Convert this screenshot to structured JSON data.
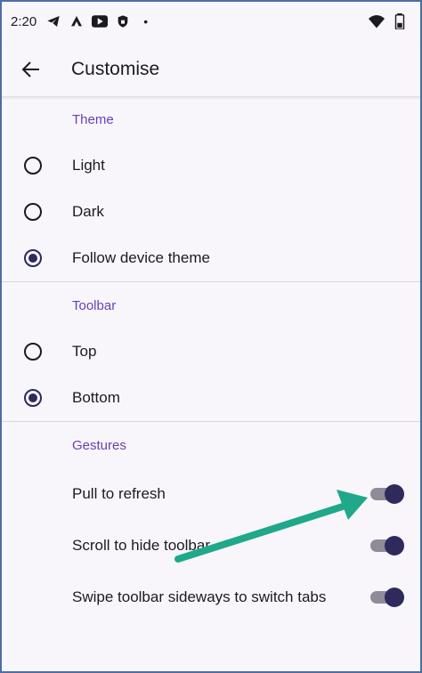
{
  "status_bar": {
    "time": "2:20",
    "dot": "•",
    "icons": [
      "telegram-icon",
      "app-icon",
      "youtube-icon",
      "vpn-lock-icon",
      "wifi-icon",
      "battery-icon"
    ]
  },
  "app_bar": {
    "title": "Customise",
    "back_icon": "arrow-back-icon"
  },
  "theme": {
    "header": "Theme",
    "options": [
      {
        "label": "Light",
        "checked": false
      },
      {
        "label": "Dark",
        "checked": false
      },
      {
        "label": "Follow device theme",
        "checked": true
      }
    ]
  },
  "toolbar": {
    "header": "Toolbar",
    "options": [
      {
        "label": "Top",
        "checked": false
      },
      {
        "label": "Bottom",
        "checked": true
      }
    ]
  },
  "gestures": {
    "header": "Gestures",
    "items": [
      {
        "label": "Pull to refresh",
        "enabled": true
      },
      {
        "label": "Scroll to hide toolbar",
        "enabled": true
      },
      {
        "label": "Swipe toolbar sideways to switch tabs",
        "enabled": true
      }
    ]
  },
  "colors": {
    "accent": "#6a3fb5",
    "control": "#2e2a5c",
    "annotation_arrow": "#1fa88a"
  }
}
